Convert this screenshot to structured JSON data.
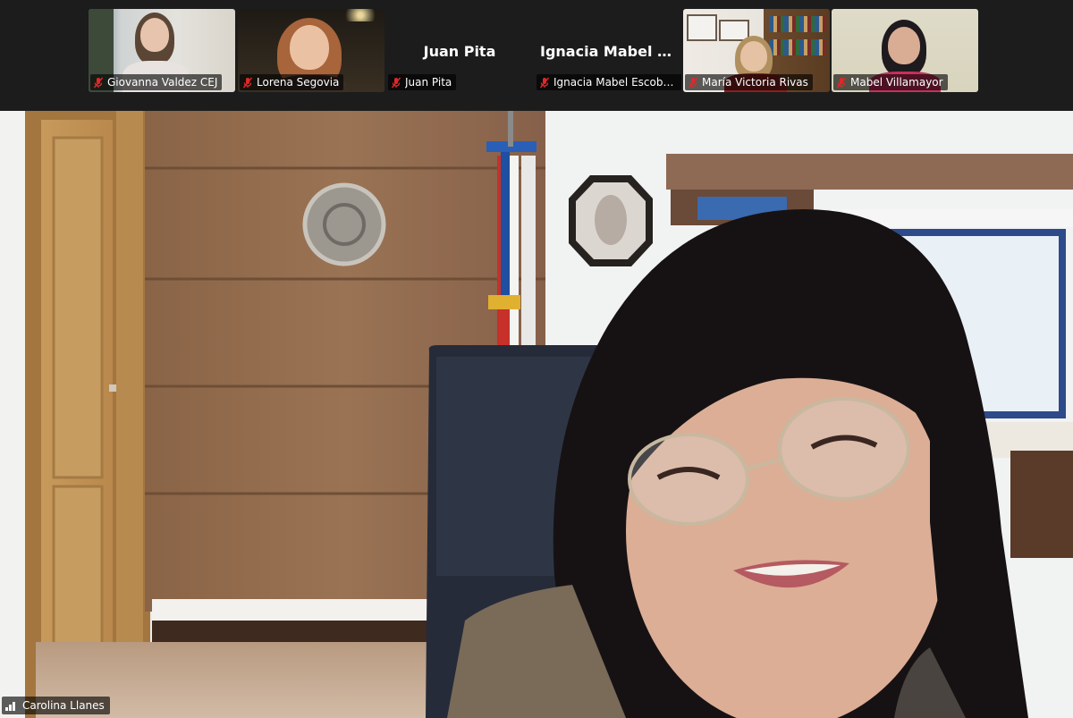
{
  "participants": [
    {
      "name": "Giovanna Valdez CEJ",
      "video": true,
      "muted": true
    },
    {
      "name": "Lorena Segovia",
      "video": true,
      "muted": true
    },
    {
      "name": "Juan Pita",
      "display_name": "Juan Pita",
      "video": false,
      "muted": true
    },
    {
      "name": "Ignacia Mabel Escobar ...",
      "display_name": "Ignacia Mabel E...",
      "video": false,
      "muted": true
    },
    {
      "name": "María Victoria Rivas",
      "video": true,
      "muted": true
    },
    {
      "name": "Mabel Villamayor",
      "video": true,
      "muted": true
    }
  ],
  "active_speaker": {
    "name": "Carolina Llanes"
  },
  "icons": {
    "muted": "mic-muted-icon",
    "signal": "signal-strength-icon"
  },
  "colors": {
    "muted_red": "#e02828",
    "strip_bg": "#1c1c1c"
  }
}
